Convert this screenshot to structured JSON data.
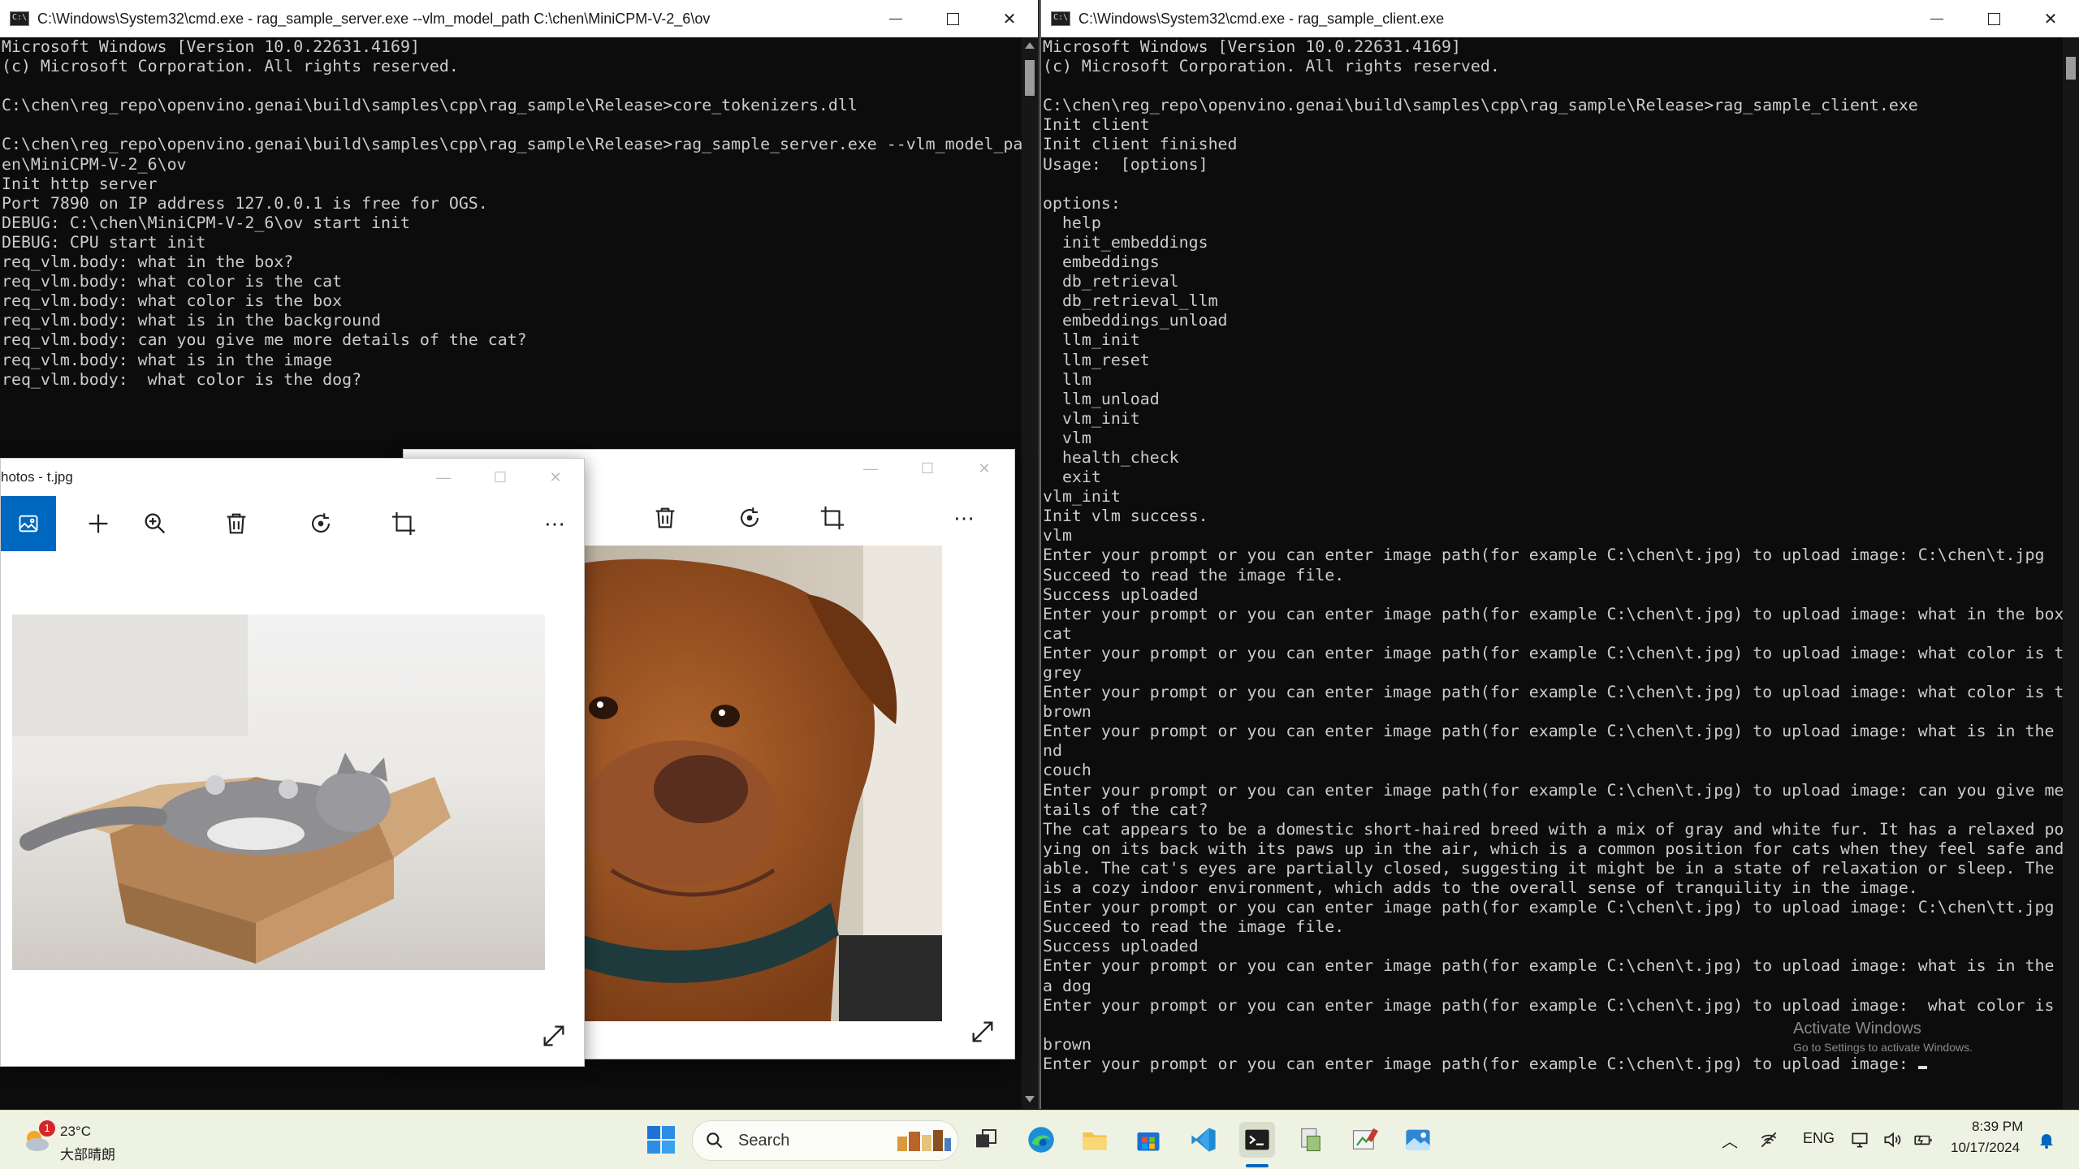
{
  "server_window": {
    "title": "C:\\Windows\\System32\\cmd.exe - rag_sample_server.exe  --vlm_model_path C:\\chen\\MiniCPM-V-2_6\\ov",
    "lines": [
      "Microsoft Windows [Version 10.0.22631.4169]",
      "(c) Microsoft Corporation. All rights reserved.",
      "",
      "C:\\chen\\reg_repo\\openvino.genai\\build\\samples\\cpp\\rag_sample\\Release>core_tokenizers.dll",
      "",
      "C:\\chen\\reg_repo\\openvino.genai\\build\\samples\\cpp\\rag_sample\\Release>rag_sample_server.exe --vlm_model_path C:\\ch",
      "en\\MiniCPM-V-2_6\\ov",
      "Init http server",
      "Port 7890 on IP address 127.0.0.1 is free for OGS.",
      "DEBUG: C:\\chen\\MiniCPM-V-2_6\\ov start init",
      "DEBUG: CPU start init",
      "req_vlm.body: what in the box?",
      "req_vlm.body: what color is the cat",
      "req_vlm.body: what color is the box",
      "req_vlm.body: what is in the background",
      "req_vlm.body: can you give me more details of the cat?",
      "req_vlm.body: what is in the image",
      "req_vlm.body:  what color is the dog?"
    ]
  },
  "client_window": {
    "title": "C:\\Windows\\System32\\cmd.exe - rag_sample_client.exe",
    "lines": [
      "Microsoft Windows [Version 10.0.22631.4169]",
      "(c) Microsoft Corporation. All rights reserved.",
      "",
      "C:\\chen\\reg_repo\\openvino.genai\\build\\samples\\cpp\\rag_sample\\Release>rag_sample_client.exe",
      "Init client",
      "Init client finished",
      "Usage:  [options]",
      "",
      "options:",
      "  help",
      "  init_embeddings",
      "  embeddings",
      "  db_retrieval",
      "  db_retrieval_llm",
      "  embeddings_unload",
      "  llm_init",
      "  llm_reset",
      "  llm",
      "  llm_unload",
      "  vlm_init",
      "  vlm",
      "  health_check",
      "  exit",
      "vlm_init",
      "Init vlm success.",
      "vlm",
      "Enter your prompt or you can enter image path(for example C:\\chen\\t.jpg) to upload image: C:\\chen\\t.jpg",
      "Succeed to read the image file.",
      "Success uploaded",
      "Enter your prompt or you can enter image path(for example C:\\chen\\t.jpg) to upload image: what in the box?",
      "cat",
      "Enter your prompt or you can enter image path(for example C:\\chen\\t.jpg) to upload image: what color is the cat",
      "grey",
      "Enter your prompt or you can enter image path(for example C:\\chen\\t.jpg) to upload image: what color is the box",
      "brown",
      "Enter your prompt or you can enter image path(for example C:\\chen\\t.jpg) to upload image: what is in the backgrou",
      "nd",
      "couch",
      "Enter your prompt or you can enter image path(for example C:\\chen\\t.jpg) to upload image: can you give me more de",
      "tails of the cat?",
      "The cat appears to be a domestic short-haired breed with a mix of gray and white fur. It has a relaxed posture, l",
      "ying on its back with its paws up in the air, which is a common position for cats when they feel safe and comfort",
      "able. The cat's eyes are partially closed, suggesting it might be in a state of relaxation or sleep. The setting",
      "is a cozy indoor environment, which adds to the overall sense of tranquility in the image.",
      "Enter your prompt or you can enter image path(for example C:\\chen\\t.jpg) to upload image: C:\\chen\\tt.jpg",
      "Succeed to read the image file.",
      "Success uploaded",
      "Enter your prompt or you can enter image path(for example C:\\chen\\t.jpg) to upload image: what is in the image",
      "a dog",
      "Enter your prompt or you can enter image path(for example C:\\chen\\t.jpg) to upload image:  what color is the dog?",
      "",
      "brown",
      "Enter your prompt or you can enter image path(for example C:\\chen\\t.jpg) to upload image: "
    ]
  },
  "photos_front": {
    "title": "hotos - t.jpg",
    "image_label": "cat in cardboard box"
  },
  "photos_back": {
    "image_label": "brown dog portrait"
  },
  "activate_windows": {
    "line1": "Activate Windows",
    "line2": "Go to Settings to activate Windows."
  },
  "taskbar": {
    "weather_badge": "1",
    "temperature": "23°C",
    "weather_desc": "大部晴朗",
    "search_label": "Search",
    "language": "ENG",
    "time": "8:39 PM",
    "date": "10/17/2024"
  },
  "colors": {
    "console_bg": "#0c0c0c",
    "console_fg": "#cccccc",
    "taskbar_bg": "#eef2e2",
    "accent": "#0067c0"
  }
}
